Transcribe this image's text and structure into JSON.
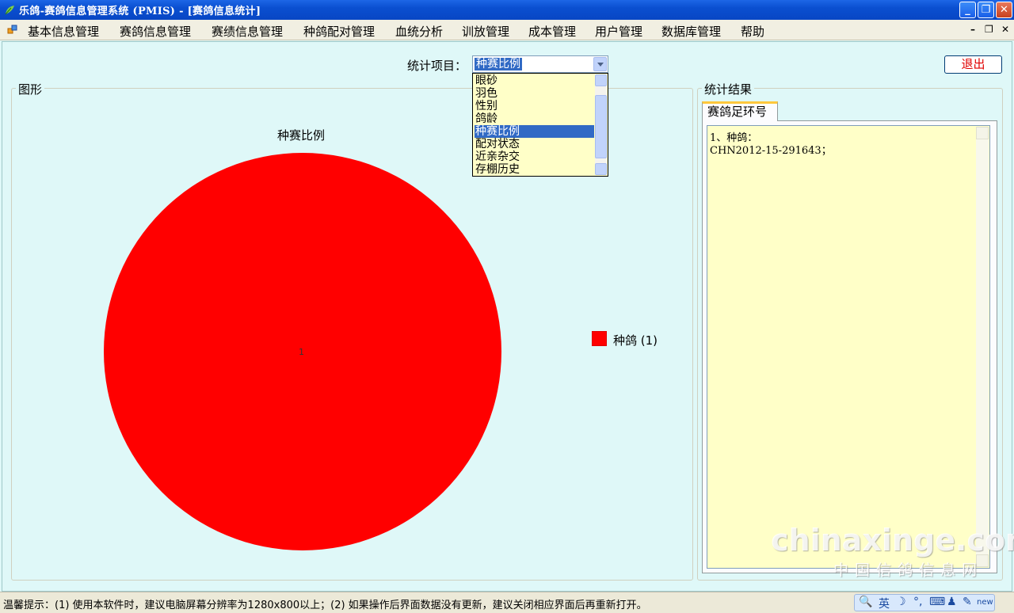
{
  "window": {
    "title": "乐鸽-赛鸽信息管理系统 (PMIS) - [赛鸽信息统计]",
    "controls": {
      "minimize": "_",
      "restore": "❐",
      "close": "✕"
    }
  },
  "menu": {
    "items": [
      "基本信息管理",
      "赛鸽信息管理",
      "赛绩信息管理",
      "种鸽配对管理",
      "血统分析",
      "训放管理",
      "成本管理",
      "用户管理",
      "数据库管理",
      "帮助"
    ],
    "mdi_controls": {
      "minimize": "–",
      "restore": "❐",
      "close": "✕"
    }
  },
  "toolbar": {
    "stat_label": "统计项目：",
    "selected": "种赛比例",
    "exit_label": "退出"
  },
  "dropdown": {
    "options": [
      "眼砂",
      "羽色",
      "性别",
      "鸽龄",
      "种赛比例",
      "配对状态",
      "近亲杂交",
      "存棚历史"
    ],
    "selected_index": 4
  },
  "graph_group": {
    "title": "图形"
  },
  "results_group": {
    "title": "统计结果"
  },
  "chart_data": {
    "type": "pie",
    "title": "种赛比例",
    "slices": [
      {
        "label": "种鸽",
        "value": 1,
        "color": "#ff0000"
      }
    ],
    "slice_labels": [
      "1"
    ],
    "legend": [
      "种鸽 (1)"
    ],
    "legend_position": "right"
  },
  "results": {
    "tab_label": "赛鸽足环号",
    "lines": [
      "1、种鸽：",
      "CHN2012-15-291643；"
    ]
  },
  "watermark": {
    "main": "chinaxinge.com",
    "sub": "中国信鸽信息网"
  },
  "status": {
    "text": "温馨提示：(1) 使用本软件时，建议电脑屏幕分辨率为1280x800以上；(2) 如果操作后界面数据没有更新，建议关闭相应界面后再重新打开。",
    "ime": [
      "英",
      "☽",
      "°,",
      "⌨",
      "♟",
      "✎",
      "new"
    ]
  }
}
